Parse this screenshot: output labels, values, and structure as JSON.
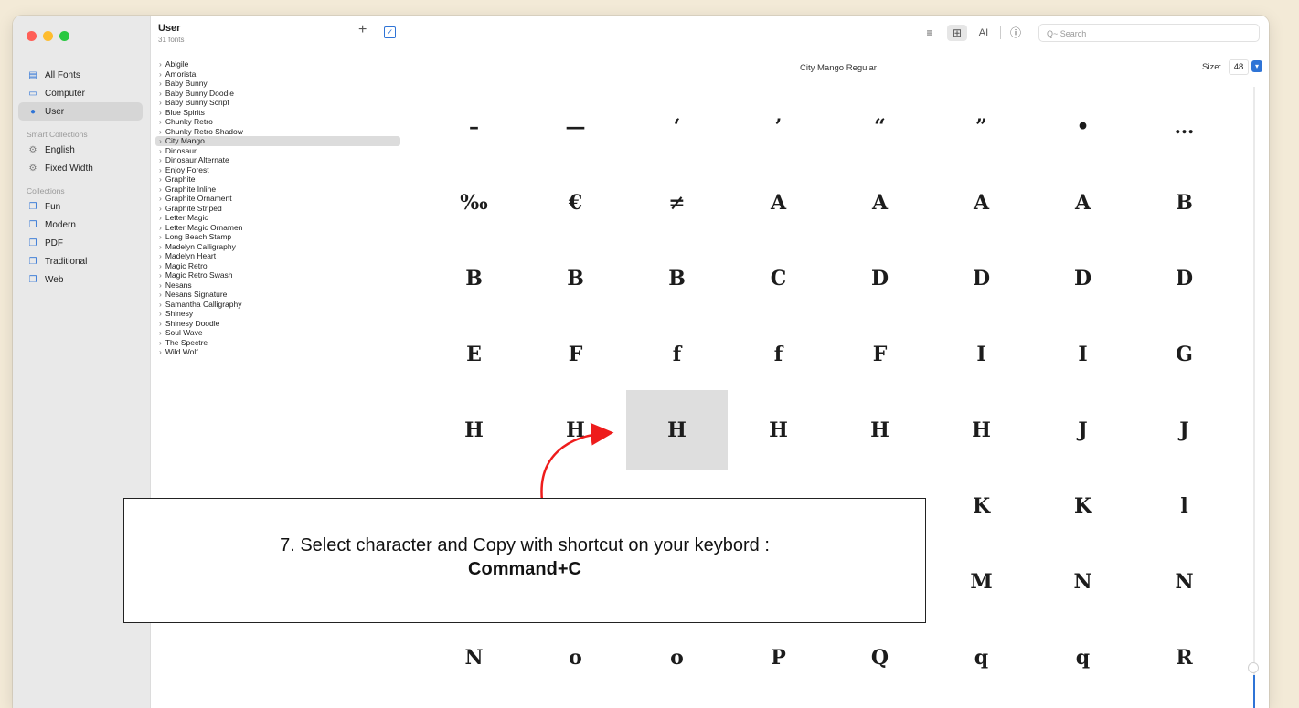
{
  "window": {
    "traffic_colors": [
      "#ff5f57",
      "#febc2e",
      "#28c840"
    ]
  },
  "sidebar": {
    "items": [
      {
        "label": "All Fonts",
        "icon": "font-box-icon"
      },
      {
        "label": "Computer",
        "icon": "monitor-icon"
      },
      {
        "label": "User",
        "icon": "user-circle-icon",
        "selected": true
      }
    ],
    "smart_header": "Smart Collections",
    "smart_items": [
      {
        "label": "English",
        "icon": "gear-icon"
      },
      {
        "label": "Fixed Width",
        "icon": "gear-icon"
      }
    ],
    "collections_header": "Collections",
    "collection_items": [
      {
        "label": "Fun",
        "icon": "collection-icon"
      },
      {
        "label": "Modern",
        "icon": "collection-icon"
      },
      {
        "label": "PDF",
        "icon": "collection-icon"
      },
      {
        "label": "Traditional",
        "icon": "collection-icon"
      },
      {
        "label": "Web",
        "icon": "collection-icon"
      }
    ]
  },
  "font_list": {
    "title": "User",
    "count": "31 fonts",
    "add_label": "+",
    "check_label": "✓",
    "selected_index": 8,
    "fonts": [
      "Abigile",
      "Amorista",
      "Baby Bunny",
      "Baby Bunny Doodle",
      "Baby Bunny Script",
      "Blue Spirits",
      "Chunky Retro",
      "Chunky Retro Shadow",
      "City Mango",
      "Dinosaur",
      "Dinosaur Alternate",
      "Enjoy Forest",
      "Graphite",
      "Graphite Inline",
      "Graphite Ornament",
      "Graphite Striped",
      "Letter Magic",
      "Letter Magic Ornamen",
      "Long Beach Stamp",
      "Madelyn Calligraphy",
      "Madelyn Heart",
      "Magic Retro",
      "Magic Retro Swash",
      "Nesans",
      "Nesans Signature",
      "Samantha Calligraphy",
      "Shinesy",
      "Shinesy Doodle",
      "Soul Wave",
      "The Spectre",
      "Wild Wolf"
    ]
  },
  "toolbar": {
    "align_icon": "≡",
    "grid_icon": "⊞",
    "text_icon": "AI",
    "info_icon": "ⓘ",
    "search_placeholder": "Q~ Search"
  },
  "preview": {
    "font_name": "City Mango Regular",
    "size_label": "Size:",
    "size_value": "48",
    "glyphs": [
      "–",
      "—",
      "‘",
      "’",
      "“",
      "”",
      "•",
      "…",
      "‰",
      "€",
      "≠",
      "A",
      "A",
      "A",
      "A",
      "B",
      "B",
      "B",
      "B",
      "C",
      "D",
      "D",
      "D",
      "D",
      "E",
      "F",
      "f",
      "f",
      "F",
      "I",
      "I",
      "G",
      "H",
      "H",
      "H",
      "H",
      "H",
      "H",
      "J",
      "J",
      "",
      "",
      "",
      "",
      "",
      "K",
      "K",
      "l",
      "",
      "",
      "",
      "",
      "",
      "M",
      "N",
      "N",
      "N",
      "o",
      "o",
      "P",
      "Q",
      "q",
      "q",
      "R"
    ],
    "selected_glyph_index": 34
  },
  "annotation": {
    "line1": "7. Select character and Copy with shortcut on your keybord :",
    "line2": "Command+C",
    "arrow_color": "#ee1c1c"
  }
}
